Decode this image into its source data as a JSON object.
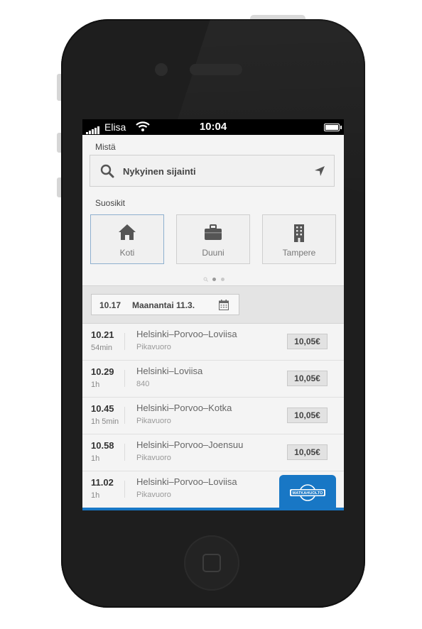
{
  "status_bar": {
    "carrier": "Elisa",
    "time": "10:04"
  },
  "from": {
    "label": "Mistä",
    "value": "Nykyinen sijainti",
    "search_icon": "search-icon",
    "locate_icon": "location-arrow-icon"
  },
  "favorites": {
    "label": "Suosikit",
    "items": [
      {
        "label": "Koti",
        "icon": "home-icon"
      },
      {
        "label": "Duuni",
        "icon": "briefcase-icon"
      },
      {
        "label": "Tampere",
        "icon": "building-icon"
      }
    ],
    "pager": {
      "pages": 3,
      "current": 2
    }
  },
  "date_picker": {
    "time": "10.17",
    "date": "Maanantai 11.3.",
    "icon": "calendar-icon"
  },
  "departures": [
    {
      "time": "10.21",
      "duration": "54min",
      "route": "Helsinki–Porvoo–Loviisa",
      "type": "Pikavuoro",
      "price": "10,05€"
    },
    {
      "time": "10.29",
      "duration": "1h",
      "route": "Helsinki–Loviisa",
      "type": "840",
      "price": "10,05€"
    },
    {
      "time": "10.45",
      "duration": "1h 5min",
      "route": "Helsinki–Porvoo–Kotka",
      "type": "Pikavuoro",
      "price": "10,05€"
    },
    {
      "time": "10.58",
      "duration": "1h",
      "route": "Helsinki–Porvoo–Joensuu",
      "type": "Pikavuoro",
      "price": "10,05€"
    },
    {
      "time": "11.02",
      "duration": "1h",
      "route": "Helsinki–Porvoo–Loviisa",
      "type": "Pikavuoro",
      "price": ""
    }
  ],
  "brand": {
    "logo_text": "MATKAHUOLTO",
    "color": "#1877c5"
  }
}
